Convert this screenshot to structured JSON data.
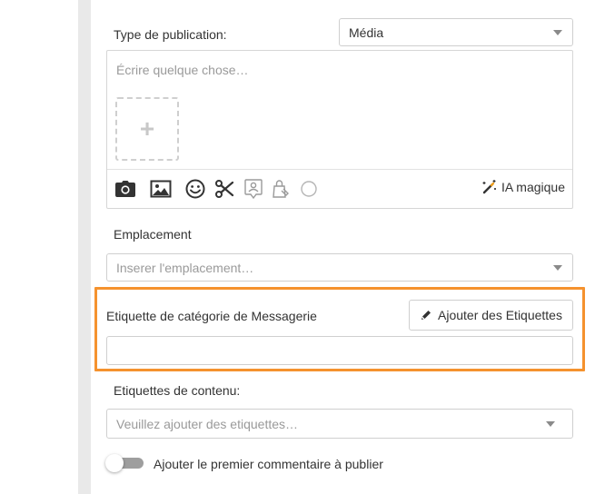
{
  "publication_type": {
    "label": "Type de publication:",
    "value": "Média"
  },
  "editor": {
    "placeholder": "Écrire quelque chose…",
    "add_media_symbol": "+",
    "tools": [
      "camera-icon",
      "image-icon",
      "smiley-icon",
      "scissors-icon",
      "user-badge-icon",
      "bag-icon",
      "circle-icon"
    ],
    "ai_label": "IA magique"
  },
  "location": {
    "label": "Emplacement",
    "placeholder": "Inserer l'emplacement…"
  },
  "messaging_category": {
    "label": "Etiquette de catégorie de Messagerie",
    "add_button_label": "Ajouter des Etiquettes",
    "input_value": ""
  },
  "content_tags": {
    "label": "Etiquettes de contenu:",
    "placeholder": "Veuillez ajouter des etiquettes…"
  },
  "first_comment": {
    "label": "Ajouter le premier commentaire à publier",
    "enabled": false
  },
  "colors": {
    "highlight": "#f5922e",
    "sidebar": "#e9e9e9",
    "border": "#cfcfcf"
  }
}
